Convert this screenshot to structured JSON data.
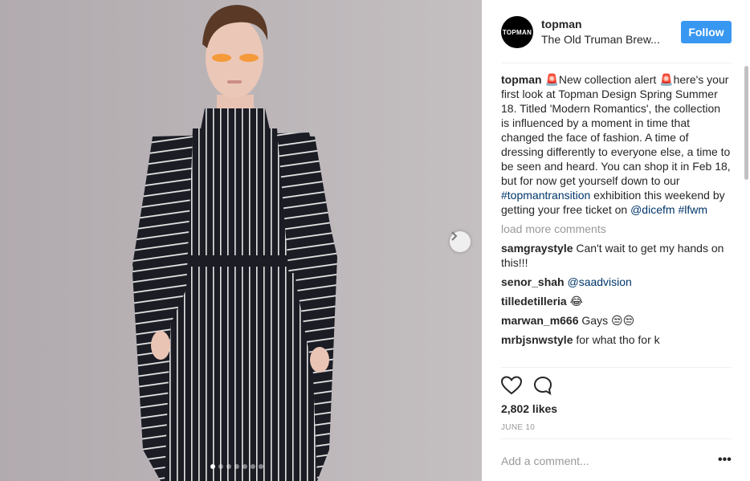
{
  "post": {
    "image_alt": "Model wearing black and white striped outfit",
    "carousel_total": 7,
    "carousel_active": 1
  },
  "header": {
    "username": "topman",
    "location": "The Old Truman Brew...",
    "follow_label": "Follow",
    "avatar_text": "TOPMAN"
  },
  "caption": {
    "username": "topman",
    "text_1": " 🚨New collection alert 🚨here's your first look at Topman Design Spring Summer 18. Titled 'Modern Romantics', the collection is influenced by a moment in time that changed the face of fashion. A time of dressing differently to everyone else, a time to be seen and heard. You can shop it in Feb 18, but for now get yourself down to our ",
    "hashtag_1": "#topmantransition",
    "text_2": " exhibition this weekend by getting your free ticket on ",
    "mention_1": "@dicefm",
    "hashtag_2": "#lfwm"
  },
  "load_more": "load more comments",
  "comments": [
    {
      "user": "samgraystyle",
      "text": " Can't wait to get my hands on this!!!"
    },
    {
      "user": "senor_shah",
      "text": " ",
      "mention": "@saadvision"
    },
    {
      "user": "tilledetilleria",
      "text": " 😂"
    },
    {
      "user": "marwan_m666",
      "text": " Gays 😒😒"
    },
    {
      "user": "mrbjsnwstyle",
      "text": " for what tho for k"
    }
  ],
  "likes": "2,802 likes",
  "date": "JUNE 10",
  "add_comment_placeholder": "Add a comment...",
  "more_label": "•••",
  "icons": [
    "heart-icon",
    "comment-icon",
    "chevron-right-icon",
    "more-icon"
  ],
  "colors": {
    "accent": "#3897f0",
    "link": "#003569",
    "muted": "#999999",
    "text": "#262626"
  }
}
